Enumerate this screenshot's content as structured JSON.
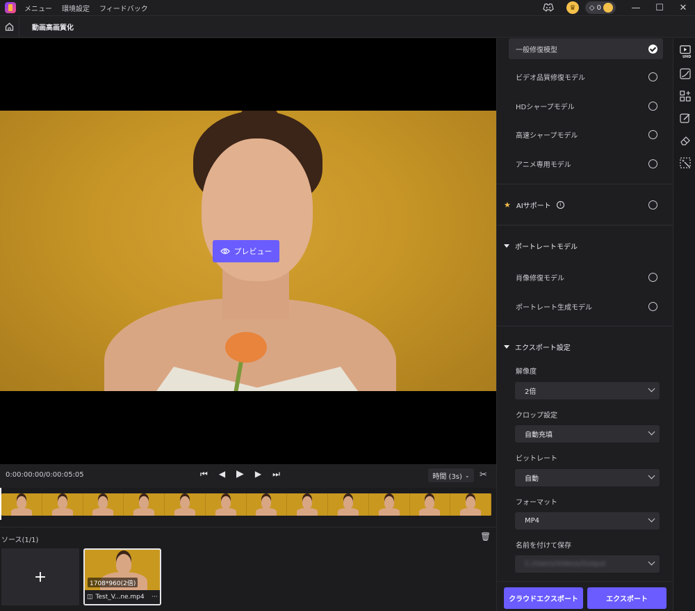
{
  "titlebar": {
    "menu": [
      "メニュー",
      "環境設定",
      "フィードバック"
    ],
    "gem_count": "0"
  },
  "header": {
    "page_title": "動画高画質化"
  },
  "preview": {
    "preview_button": "プレビュー"
  },
  "controls": {
    "timecode": "0:00:00:00/0:00:05:05",
    "time_select": "時間 (3s)"
  },
  "source": {
    "title": "ソース(1/1)",
    "add_label": "+",
    "media": {
      "resolution": "1708*960(2倍)",
      "filename": "Test_V...ne.mp4",
      "more": "···"
    }
  },
  "settings": {
    "models": [
      {
        "label": "一般修復模型",
        "selected": true
      },
      {
        "label": "ビデオ品質修復モデル",
        "selected": false
      },
      {
        "label": "HDシャープモデル",
        "selected": false
      },
      {
        "label": "高速シャープモデル",
        "selected": false
      },
      {
        "label": "アニメ専用モデル",
        "selected": false
      }
    ],
    "ai_support": "AIサポート",
    "portrait_section": "ポートレートモデル",
    "portrait_models": [
      {
        "label": "肖像修復モデル"
      },
      {
        "label": "ポートレート生成モデル"
      }
    ],
    "export_section": "エクスポート設定",
    "fields": [
      {
        "label": "解像度",
        "value": "2倍"
      },
      {
        "label": "クロップ設定",
        "value": "自動充填"
      },
      {
        "label": "ビットレート",
        "value": "自動"
      },
      {
        "label": "フォーマット",
        "value": "MP4"
      },
      {
        "label": "名前を付けて保存",
        "value": "C:/Users/Videos/Output"
      }
    ]
  },
  "export_bar": {
    "cloud_export": "クラウドエクスポート",
    "export": "エクスポート"
  },
  "rail": {
    "icons": [
      "uhd-video-icon",
      "curve-icon",
      "grid-add-icon",
      "edit-icon",
      "eraser-icon",
      "magic-select-icon"
    ],
    "uhd_label": "UHD"
  }
}
